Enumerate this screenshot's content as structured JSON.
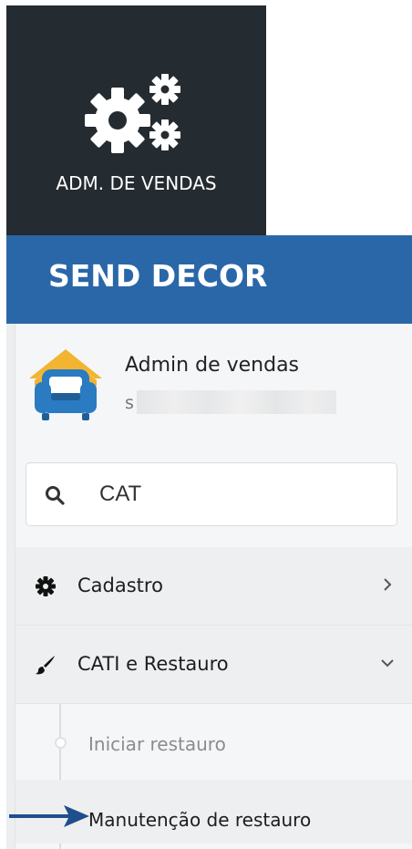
{
  "tile": {
    "icon": "gears-icon",
    "label": "ADM. DE VENDAS",
    "background": "#242b31"
  },
  "brand": {
    "name": "SEND DECOR",
    "color": "#2a67a8"
  },
  "user": {
    "avatar_icon": "house-armchair-icon",
    "name": "Admin de vendas",
    "email_visible": "s"
  },
  "search": {
    "icon": "search-icon",
    "value": "CAT"
  },
  "menu": {
    "items": [
      {
        "label": "Cadastro",
        "icon": "gear-icon",
        "chevron": "chevron-right-icon"
      },
      {
        "label": "CATI e Restauro",
        "icon": "brush-icon",
        "chevron": "chevron-down-icon"
      }
    ],
    "subitems": [
      {
        "label": "Iniciar restauro"
      },
      {
        "label": "Manutenção de restauro"
      }
    ]
  },
  "annotation": {
    "icon": "arrow-right-icon",
    "color": "#1f4e8c"
  }
}
